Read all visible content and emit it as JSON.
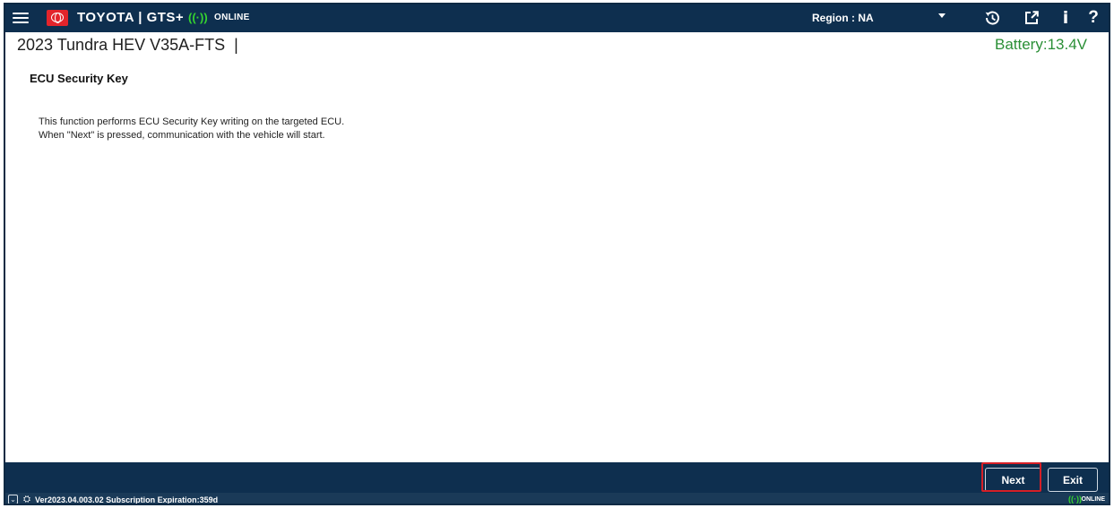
{
  "topbar": {
    "brand": "TOYOTA | GTS+",
    "connection_status": "ONLINE",
    "region_label": "Region : NA",
    "icons": {
      "menu": "hamburger-icon",
      "logo": "toyota-logo-icon",
      "signal": "signal-icon",
      "history": "history-icon",
      "external": "external-link-icon",
      "info": "info-icon",
      "help": "help-icon"
    },
    "info_glyph": "i",
    "help_glyph": "?"
  },
  "vehicle": {
    "name": "2023 Tundra HEV V35A-FTS",
    "separator": "|",
    "battery": "Battery:13.4V"
  },
  "main": {
    "title": "ECU Security Key",
    "lines": [
      "This function performs ECU Security Key writing on the targeted ECU.",
      "When \"Next\" is pressed, communication with the vehicle will start."
    ]
  },
  "actions": {
    "next_label": "Next",
    "exit_label": "Exit"
  },
  "statusbar": {
    "version_text": "Ver2023.04.003.02  Subscription Expiration:359d",
    "connection_status": "ONLINE"
  },
  "colors": {
    "bar_background": "#0e2f4f",
    "battery_green": "#2a8f36",
    "signal_green": "#35d42f",
    "toyota_red": "#e3242b",
    "highlight_red": "#d51f26"
  }
}
